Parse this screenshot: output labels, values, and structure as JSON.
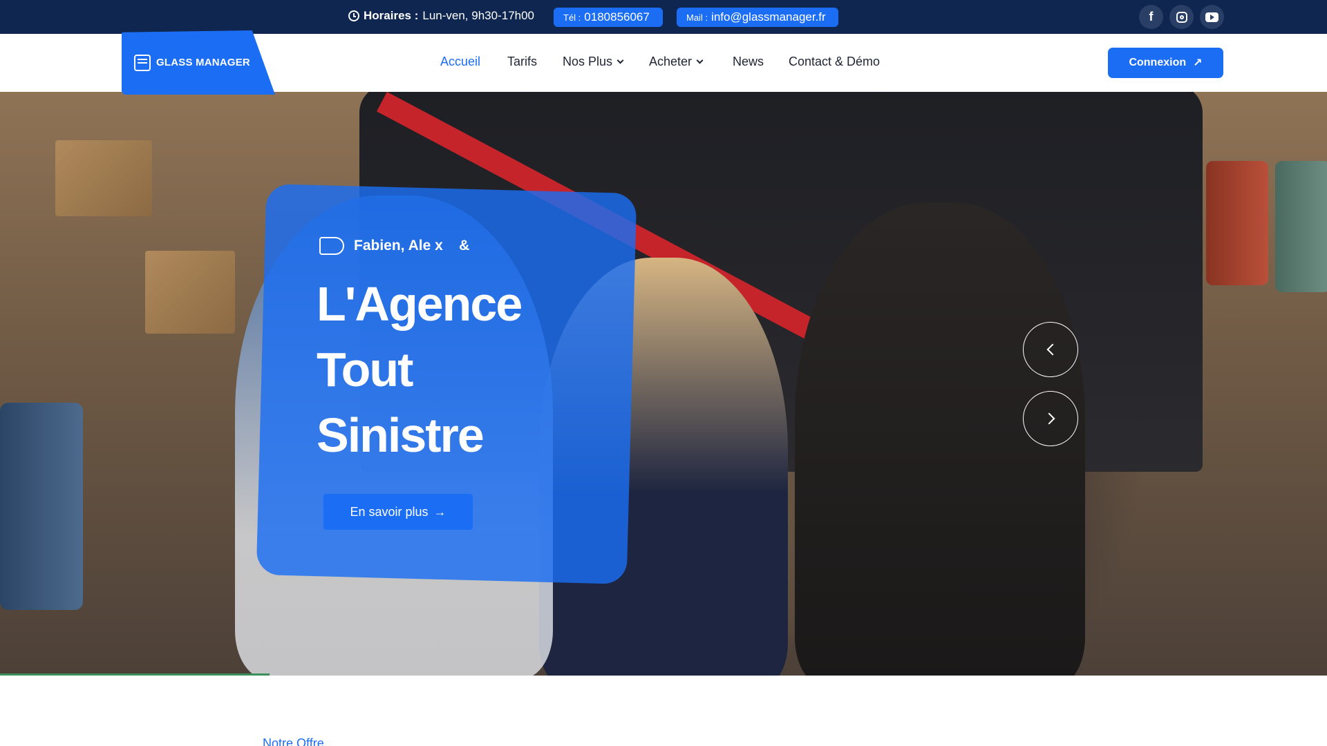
{
  "topbar": {
    "hours_label": "Horaires :",
    "hours_value": "Lun-ven, 9h30-17h00",
    "tel_label": "Tél :",
    "tel_value": "0180856067",
    "mail_label": "Mail :",
    "mail_value": "info@glassmanager.fr",
    "social": [
      "facebook-icon",
      "instagram-icon",
      "youtube-icon"
    ]
  },
  "logo": {
    "text": "GLASS MANAGER"
  },
  "nav": {
    "items": [
      {
        "label": "Accueil",
        "active": true
      },
      {
        "label": "Tarifs"
      },
      {
        "label": "Nos Plus",
        "dropdown": true
      },
      {
        "label": "Acheter",
        "dropdown": true
      },
      {
        "label": "News"
      },
      {
        "label": "Contact & Démo"
      }
    ],
    "login_label": "Connexion"
  },
  "hero": {
    "kicker": "Fabien, Ale x    &",
    "title_lines": [
      "L'Agence",
      "Tout",
      "Sinistre"
    ],
    "cta_label": "En savoir plus",
    "cta_arrow": "→"
  },
  "section": {
    "label": "Notre Offre"
  },
  "colors": {
    "topbar_bg": "#0f2650",
    "accent": "#1b6ef3",
    "nav_text": "#1d2433"
  }
}
